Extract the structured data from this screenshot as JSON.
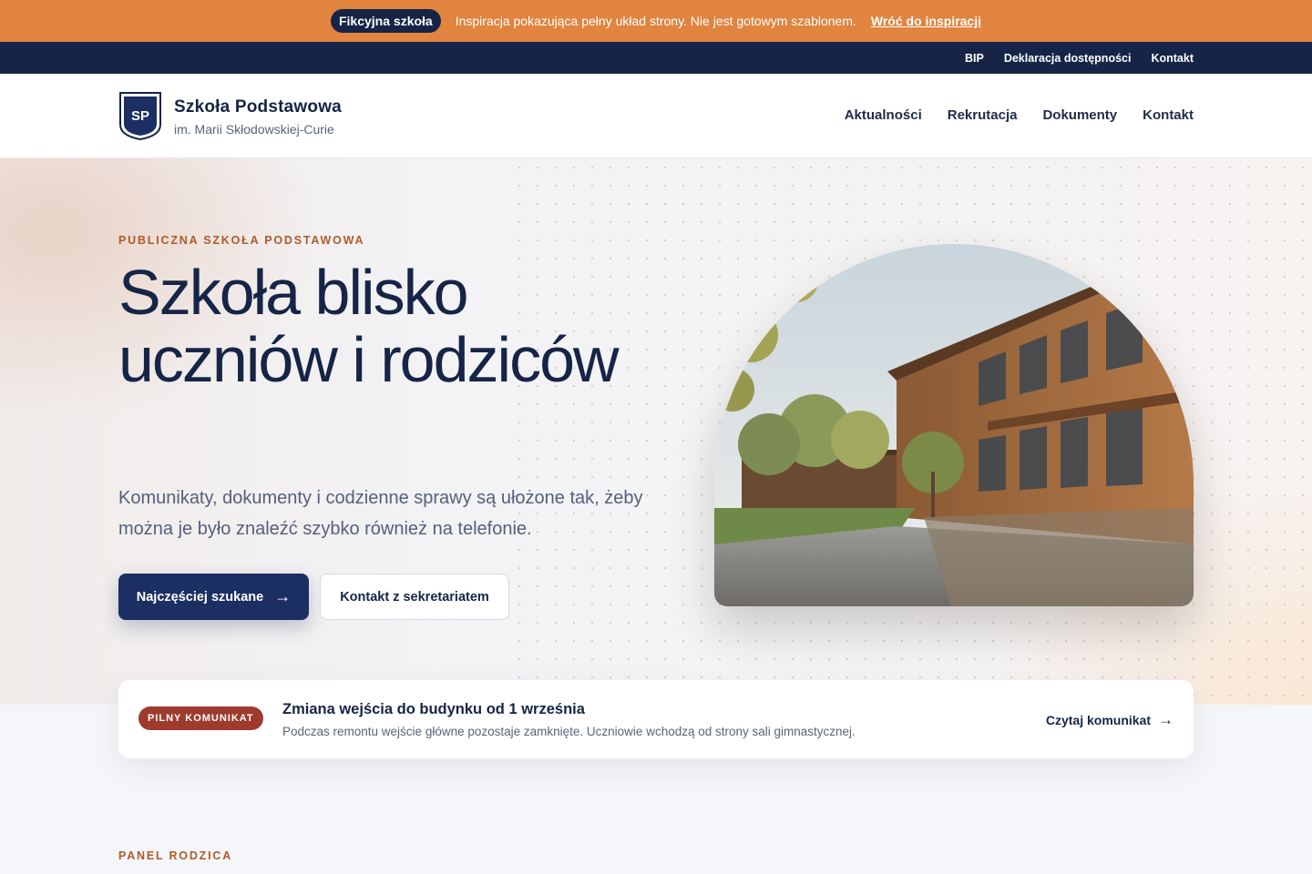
{
  "promo": {
    "badge": "Fikcyjna szkoła",
    "text": "Inspiracja pokazująca pełny układ strony. Nie jest gotowym szablonem.",
    "link": "Wróć do inspiracji"
  },
  "utility_nav": [
    "BIP",
    "Deklaracja dostępności",
    "Kontakt"
  ],
  "header": {
    "logo_text": "SP",
    "school_name": "Szkoła Podstawowa",
    "school_patron": "im. Marii Skłodowskiej-Curie",
    "nav": [
      "Aktualności",
      "Rekrutacja",
      "Dokumenty",
      "Kontakt"
    ]
  },
  "hero": {
    "eyebrow": "PUBLICZNA SZKOŁA PODSTAWOWA",
    "title": "Szkoła blisko uczniów i rodziców",
    "lead": "Komunikaty, dokumenty i codzienne sprawy są ułożone tak, żeby można je było znaleźć szybko również na telefonie.",
    "primary_button": "Najczęściej szukane",
    "secondary_button": "Kontakt z sekretariatem",
    "arrow": "→"
  },
  "alert": {
    "badge": "PILNY KOMUNIKAT",
    "title": "Zmiana wejścia do budynku od 1 września",
    "text": "Podczas remontu wejście główne pozostaje zamknięte. Uczniowie wchodzą od strony sali gimnastycznej.",
    "link": "Czytaj komunikat",
    "arrow": "→"
  },
  "next_section": {
    "eyebrow": "PANEL RODZICA"
  },
  "colors": {
    "promo_bg": "#e0843f",
    "navy": "#162447",
    "accent": "#b05a2a",
    "alert_badge": "#9e3a2e"
  }
}
